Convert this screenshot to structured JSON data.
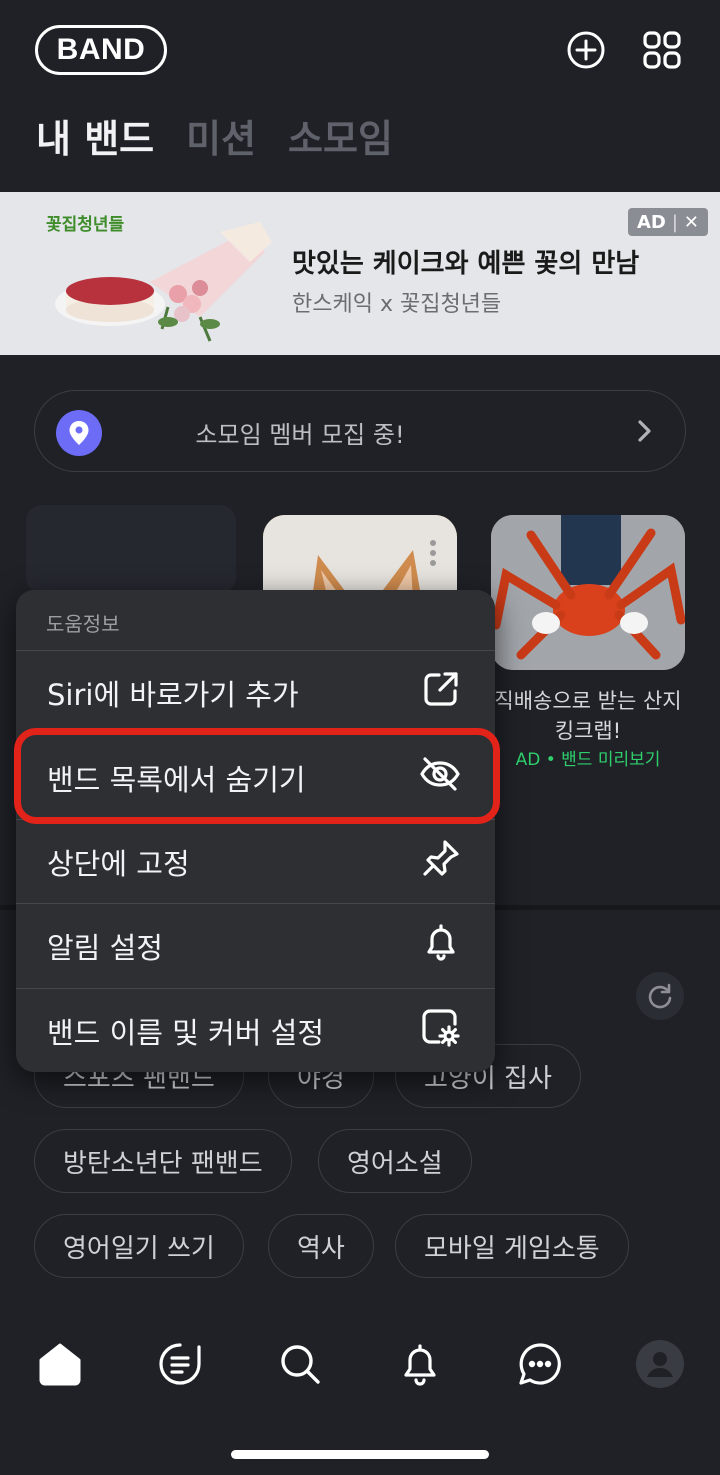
{
  "header": {
    "logo": "BAND",
    "tabs": [
      {
        "label": "내 밴드",
        "active": true
      },
      {
        "label": "미션",
        "active": false
      },
      {
        "label": "소모임",
        "active": false
      }
    ]
  },
  "ad_banner": {
    "brand": "꽃집청년들",
    "title": "맛있는 케이크와 예쁜 꽃의 만남",
    "subtitle": "한스케익 x 꽃집청년들",
    "badge": "AD"
  },
  "recruit": {
    "label": "소모임 멤버 모집 중!"
  },
  "cards": {
    "crab_title": "직배송으로 받는 산지 킹크랩!",
    "crab_ad": "AD • 밴드 미리보기"
  },
  "context_menu": {
    "header": "도움정보",
    "items": [
      {
        "label": "Siri에 바로가기 추가",
        "icon": "share-icon"
      },
      {
        "label": "밴드 목록에서 숨기기",
        "icon": "eye-slash-icon"
      },
      {
        "label": "상단에 고정",
        "icon": "pin-icon"
      },
      {
        "label": "알림 설정",
        "icon": "bell-icon"
      },
      {
        "label": "밴드 이름 및 커버 설정",
        "icon": "settings-icon"
      }
    ]
  },
  "chips": [
    {
      "label": "스포츠 팬밴드"
    },
    {
      "label": "야경"
    },
    {
      "label": "고양이 집사"
    },
    {
      "label": "방탄소년단 팬밴드"
    },
    {
      "label": "영어소설"
    },
    {
      "label": "영어일기 쓰기"
    },
    {
      "label": "역사"
    },
    {
      "label": "모바일 게임소통"
    }
  ],
  "colors": {
    "background": "#1f2127",
    "accent_purple": "#6d6cf7",
    "highlight_red": "#e2231a",
    "ad_green": "#2fcf6c"
  }
}
